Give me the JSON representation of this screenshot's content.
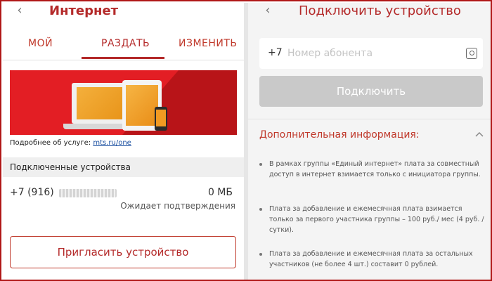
{
  "left": {
    "header": {
      "title": "Интернет",
      "back_icon": "chevron-left-icon"
    },
    "tabs": [
      {
        "label": "МОЙ",
        "active": false
      },
      {
        "label": "РАЗДАТЬ",
        "active": true
      },
      {
        "label": "ИЗМЕНИТЬ",
        "active": false
      }
    ],
    "more": {
      "prefix": "Подробнее об услуге: ",
      "link": "mts.ru/one"
    },
    "section_title": "Подключенные устройства",
    "device": {
      "number": "+7 (916)",
      "traffic": "0 МБ",
      "status": "Ожидает подтверждения"
    },
    "invite_button": "Пригласить устройство"
  },
  "right": {
    "header": {
      "title": "Подключить устройство",
      "back_icon": "chevron-left-icon"
    },
    "phone_prefix": "+7",
    "phone_placeholder": "Номер абонента",
    "phone_value": "",
    "connect_button": "Подключить",
    "info_title": "Дополнительная информация:",
    "bullets": [
      "В рамках группы «Единый интернет» плата за совместный доступ в интернет взимается только с инициатора группы.",
      "Плата за добавление и ежемесячная плата взимается только за первого участника группы – 100 руб./ мес (4 руб. / сутки).",
      "Плата за добавление и ежемесячная плата за остальных участников (не более 4 шт.) составит 0 рублей."
    ]
  },
  "colors": {
    "accent": "#b42a2a",
    "banner": "#e31e24",
    "link": "#1a4fa0",
    "disabled_button": "#c9c9c9"
  }
}
